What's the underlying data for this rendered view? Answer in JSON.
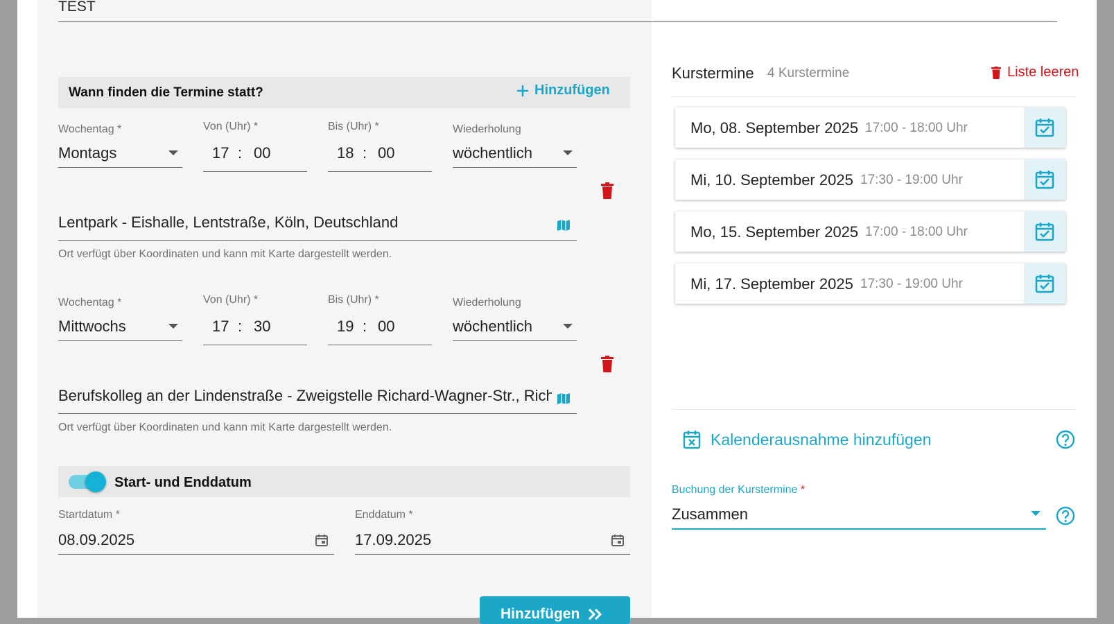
{
  "form": {
    "title_value": "TEST",
    "schedule_section_title": "Wann finden die Termine statt?",
    "add_link_label": "Hinzufügen",
    "field_labels": {
      "weekday": "Wochentag *",
      "from": "Von (Uhr) *",
      "to": "Bis (Uhr) *",
      "repeat": "Wiederholung"
    },
    "slots": [
      {
        "weekday": "Montags",
        "from_h": "17",
        "from_m": "00",
        "to_h": "18",
        "to_m": "00",
        "repeat": "wöchentlich",
        "location": "Lentpark - Eishalle, Lentstraße, Köln, Deutschland",
        "location_help": "Ort verfügt über Koordinaten und kann mit Karte dargestellt werden."
      },
      {
        "weekday": "Mittwochs",
        "from_h": "17",
        "from_m": "30",
        "to_h": "19",
        "to_m": "00",
        "repeat": "wöchentlich",
        "location": "Berufskolleg an der Lindenstraße - Zweigstelle Richard-Wagner-Str., Rich",
        "location_help": "Ort verfügt über Koordinaten und kann mit Karte dargestellt werden."
      }
    ],
    "time_sep": ":",
    "date_toggle_label": "Start- und Enddatum",
    "start_label": "Startdatum *",
    "start_value": "08.09.2025",
    "end_label": "Enddatum *",
    "end_value": "17.09.2025",
    "submit_label": "Hinzufügen"
  },
  "sidebar": {
    "title": "Kurstermine",
    "count_label": "4 Kurstermine",
    "clear_label": "Liste leeren",
    "items": [
      {
        "date": "Mo, 08. September 2025",
        "time": "17:00 - 18:00 Uhr"
      },
      {
        "date": "Mi, 10. September 2025",
        "time": "17:30 - 19:00 Uhr"
      },
      {
        "date": "Mo, 15. September 2025",
        "time": "17:00 - 18:00 Uhr"
      },
      {
        "date": "Mi, 17. September 2025",
        "time": "17:30 - 19:00 Uhr"
      }
    ],
    "exception_label": "Kalenderausnahme hinzufügen",
    "booking_label": "Buchung der Kurstermine",
    "booking_required": "*",
    "booking_value": "Zusammen"
  },
  "colors": {
    "accent": "#1ca7c9",
    "danger": "#d0161b",
    "panel_bg": "#f5f5f5",
    "frame": "#9e9e9e"
  },
  "icons": [
    "plus-icon",
    "chevron-down-icon",
    "trash-icon",
    "map-icon",
    "calendar-icon",
    "calendar-check-icon",
    "calendar-remove-icon",
    "help-icon",
    "double-chevron-right-icon"
  ]
}
